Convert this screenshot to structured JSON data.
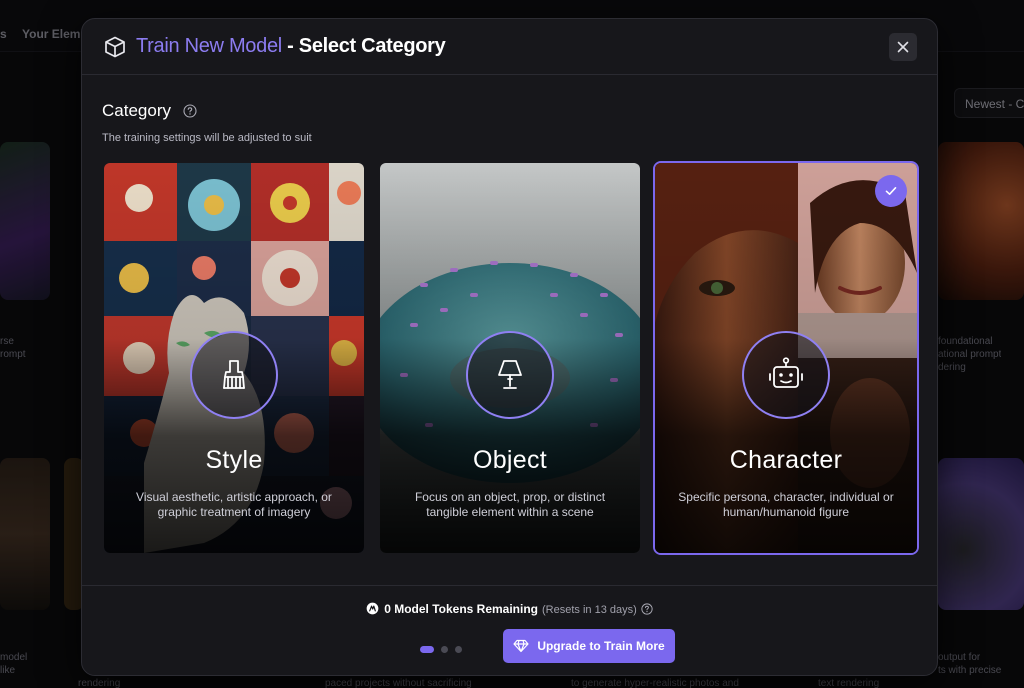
{
  "background": {
    "nav_items": [
      "s",
      "Your Elem"
    ],
    "sort_label": "Newest - C",
    "snippets_left": [
      "rse",
      "rompt",
      "model",
      "like",
      "rendering"
    ],
    "snippets_right": [
      "foundational",
      "ational prompt",
      "dering",
      "output for",
      "ts with precise",
      "text rendering"
    ],
    "snippets_bottom": [
      "paced projects without sacrificing",
      "to generate hyper-realistic photos and"
    ]
  },
  "modal": {
    "title_accent": "Train New Model",
    "title_rest": " - Select Category",
    "close_icon": "close-icon"
  },
  "category": {
    "title": "Category",
    "description": "The training settings will be adjusted to suit"
  },
  "cards": [
    {
      "name": "Style",
      "description": "Visual aesthetic, artistic approach, or graphic treatment of imagery",
      "icon": "brush-icon",
      "selected": false
    },
    {
      "name": "Object",
      "description": "Focus on an object, prop, or distinct tangible element within a scene",
      "icon": "lamp-icon",
      "selected": false
    },
    {
      "name": "Character",
      "description": "Specific persona, character, individual or human/humanoid figure",
      "icon": "robot-icon",
      "selected": true
    }
  ],
  "footer": {
    "tokens_text": "0 Model Tokens Remaining",
    "tokens_sub": "(Resets in 13 days)",
    "upgrade_label": "Upgrade to Train More",
    "pager_active_index": 0,
    "pager_count": 3
  },
  "colors": {
    "accent": "#7b68ee",
    "accent_light": "#8c7cf0",
    "modal_bg": "#17171b"
  }
}
